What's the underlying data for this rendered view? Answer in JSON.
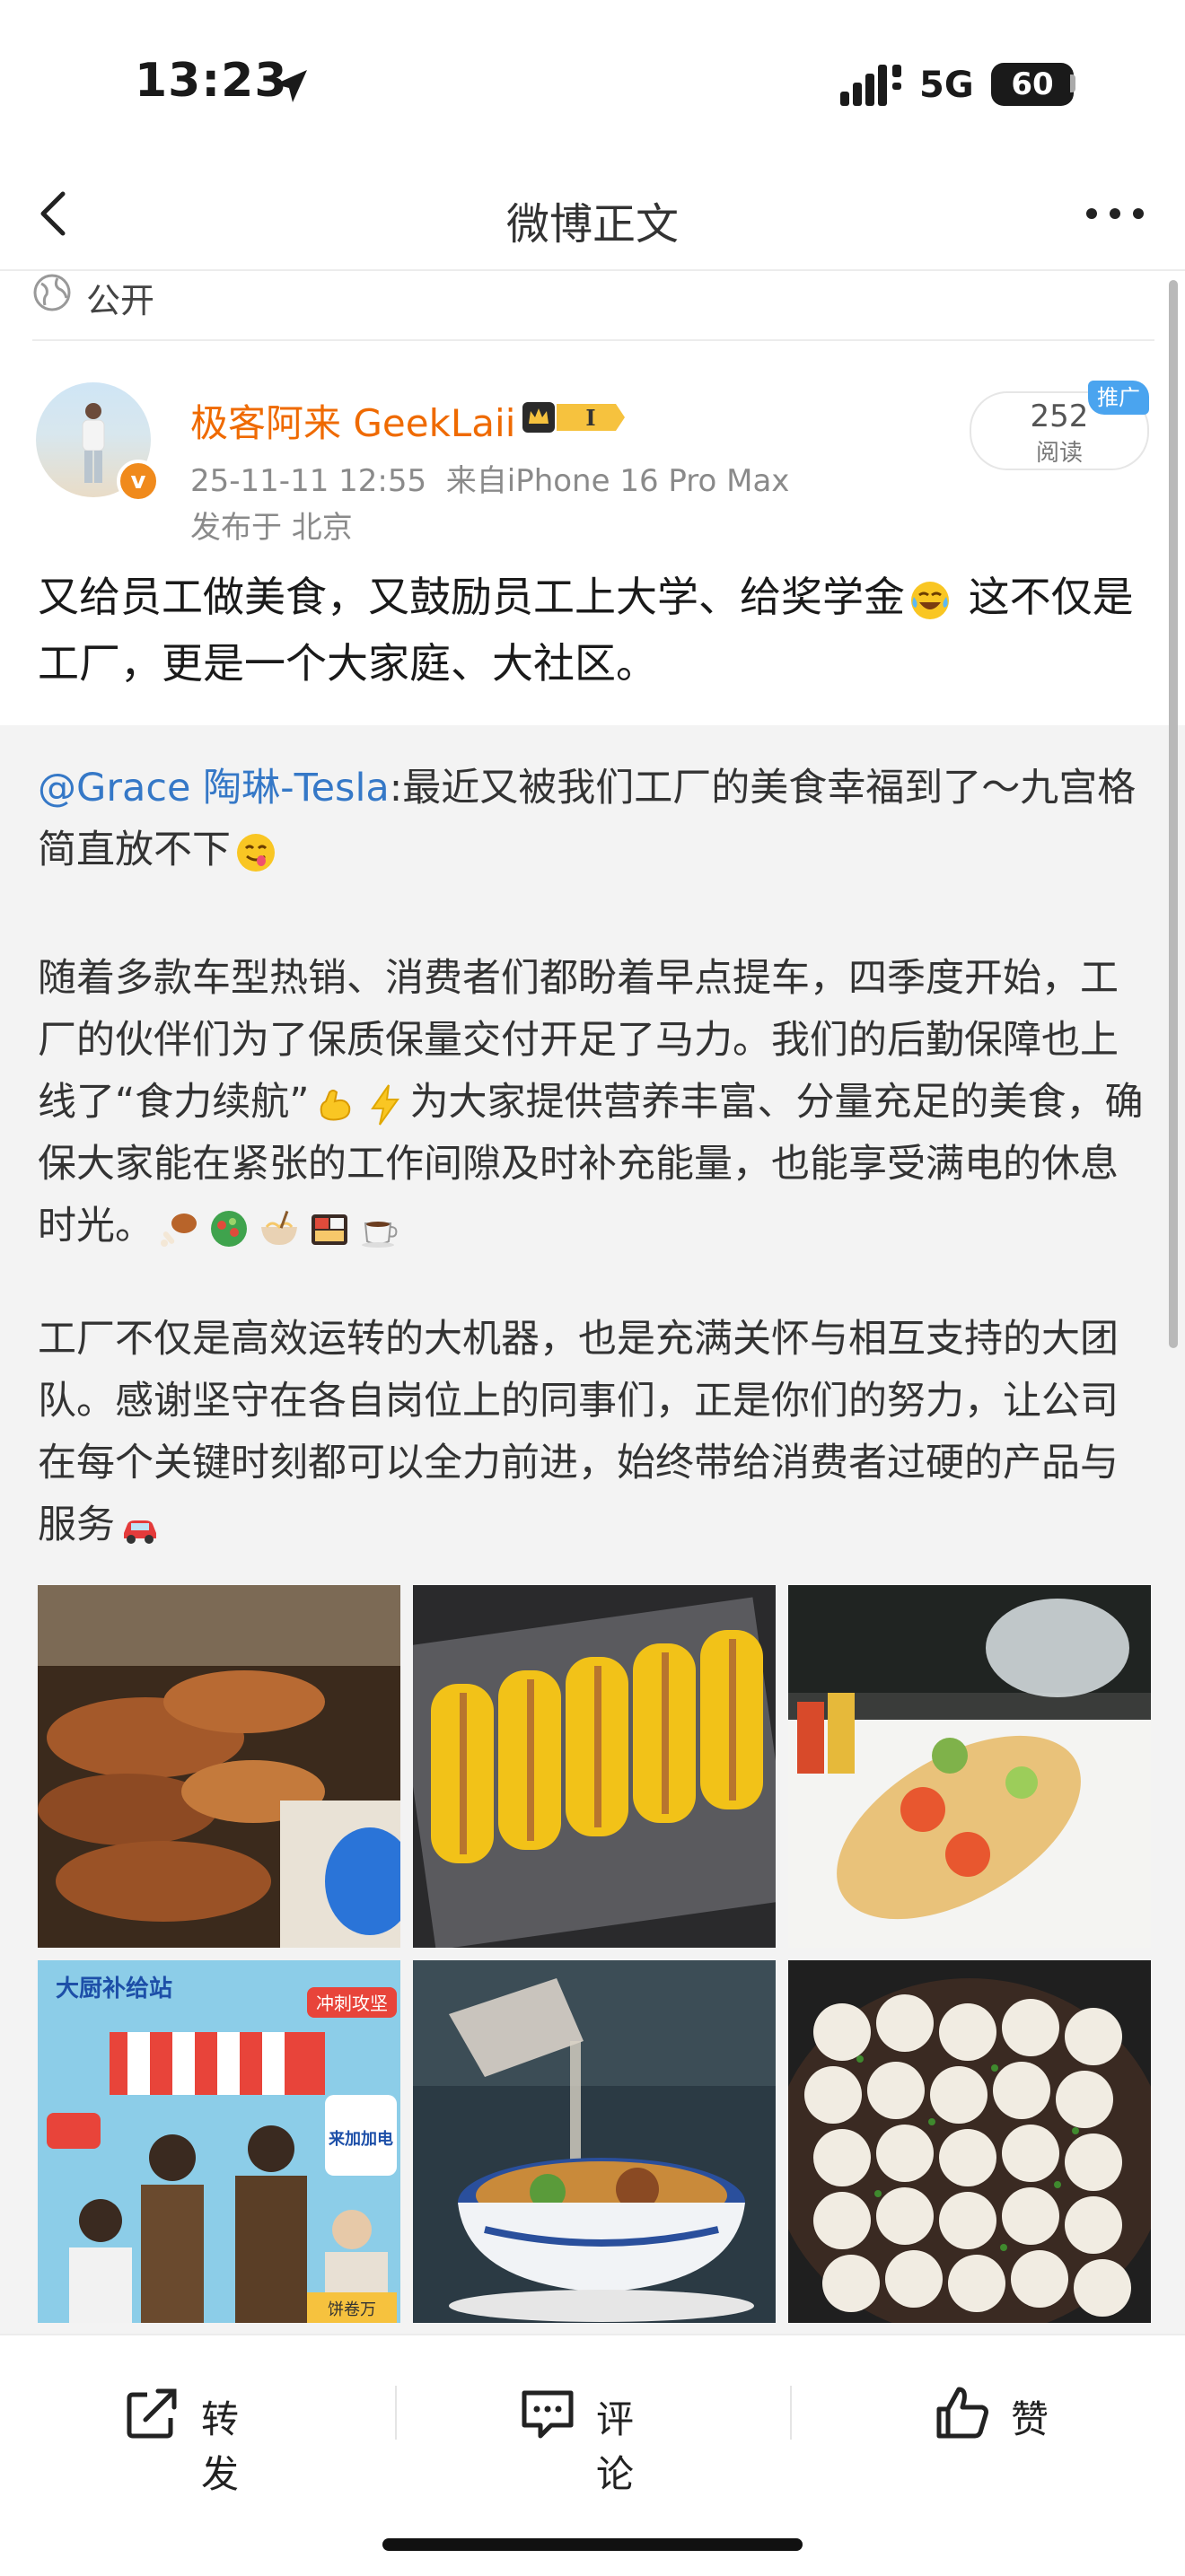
{
  "status_bar": {
    "time": "13:23",
    "network": "5G",
    "battery": "60"
  },
  "nav": {
    "title": "微博正文"
  },
  "visibility": "公开",
  "author": {
    "name": "极客阿来 GeekLaii",
    "level_badge": "I",
    "verified_badge": "v",
    "timestamp": "25-11-11 12:55",
    "source": "来自iPhone 16 Pro Max",
    "location": "发布于 北京"
  },
  "read_counter": {
    "count": "252",
    "label": "阅读",
    "promo_tag": "推广"
  },
  "post": {
    "text_part1": "又给员工做美食，又鼓励员工上大学、给奖学金",
    "text_part2": " 这不仅是工厂，更是一个大家庭、大社区。"
  },
  "repost": {
    "mention": "@Grace 陶琳-Tesla",
    "line1": ":最近又被我们工厂的美食幸福到了～九宫格简直放不下",
    "para2_part1": "随着多款车型热销、消费者们都盼着早点提车，四季度开始，工厂的伙伴们为了保质保量交付开足了马力。我们的后勤保障也上线了“食力续航”",
    "para2_part2": "为大家提供营养丰富、分量充足的美食，确保大家能在紧张的工作间隙及时补充能量，也能享受满电的休息时光。",
    "para3": "工厂不仅是高效运转的大机器，也是充满关怀与相互支持的大团队。感谢坚守在各自岗位上的同事们，正是你们的努力，让公司在每个关键时刻都可以全力前进，始终带给消费者过硬的产品与服务"
  },
  "images": {
    "img4_banner": "大厨补给站",
    "img4_tag1": "冲刺攻坚",
    "img4_sign": "来加加电",
    "img4_sign2": "饼卷万"
  },
  "actions": {
    "repost": "转发",
    "comment": "评论",
    "like": "赞"
  },
  "colors": {
    "accent_orange": "#ef6a00",
    "mention_blue": "#3578c7",
    "promo_blue": "#4aa4ef"
  }
}
